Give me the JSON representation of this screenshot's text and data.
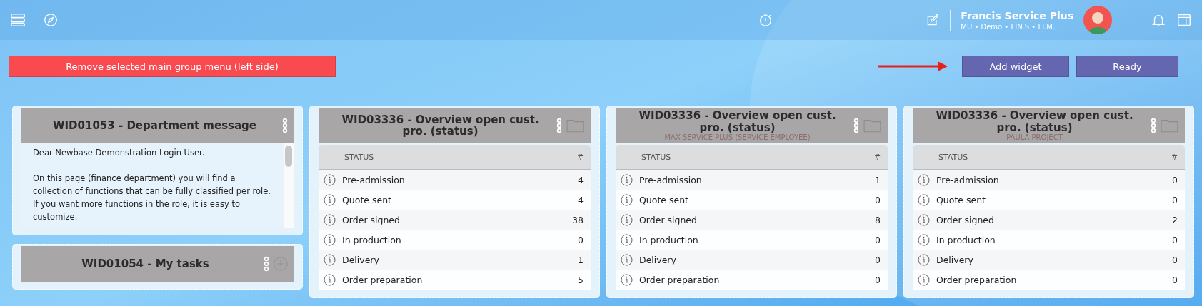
{
  "toolbar": {
    "user_name": "Francis Service Plus",
    "user_context": "MU • Demo • FIN.S • FI.M..."
  },
  "actions": {
    "remove_button": "Remove selected main group menu (left side)",
    "add_widget_button": "Add widget",
    "ready_button": "Ready"
  },
  "columns": [
    {
      "widgets": [
        {
          "kind": "message",
          "title": "WID01053 - Department message",
          "paragraphs": [
            "Dear Newbase Demonstration Login User.",
            "On this page (finance department) you will find a collection of functions that can be fully classified per role.",
            "If you want more functions in the role, it is easy to customize."
          ]
        },
        {
          "kind": "tasks",
          "title": "WID01054 - My tasks"
        }
      ]
    },
    {
      "widgets": [
        {
          "kind": "status_table",
          "title": "WID03336 - Overview open cust. pro. (status)",
          "columns": [
            "STATUS",
            "#"
          ],
          "rows": [
            {
              "status": "Pre-admission",
              "count": "4"
            },
            {
              "status": "Quote sent",
              "count": "4"
            },
            {
              "status": "Order signed",
              "count": "38"
            },
            {
              "status": "In production",
              "count": "0"
            },
            {
              "status": "Delivery",
              "count": "1"
            },
            {
              "status": "Order preparation",
              "count": "5"
            }
          ]
        }
      ]
    },
    {
      "widgets": [
        {
          "kind": "status_table",
          "title": "WID03336 - Overview open cust. pro. (status)",
          "subtitle": "MAX SERVICE PLUS (SERVICE EMPLOYEE)",
          "columns": [
            "STATUS",
            "#"
          ],
          "rows": [
            {
              "status": "Pre-admission",
              "count": "1"
            },
            {
              "status": "Quote sent",
              "count": "0"
            },
            {
              "status": "Order signed",
              "count": "8"
            },
            {
              "status": "In production",
              "count": "0"
            },
            {
              "status": "Delivery",
              "count": "0"
            },
            {
              "status": "Order preparation",
              "count": "0"
            }
          ]
        }
      ]
    },
    {
      "widgets": [
        {
          "kind": "status_table",
          "title": "WID03336 - Overview open cust. pro. (status)",
          "subtitle": "PAULA PROJECT",
          "columns": [
            "STATUS",
            "#"
          ],
          "rows": [
            {
              "status": "Pre-admission",
              "count": "0"
            },
            {
              "status": "Quote sent",
              "count": "0"
            },
            {
              "status": "Order signed",
              "count": "2"
            },
            {
              "status": "In production",
              "count": "0"
            },
            {
              "status": "Delivery",
              "count": "0"
            },
            {
              "status": "Order preparation",
              "count": "0"
            }
          ]
        }
      ]
    }
  ]
}
